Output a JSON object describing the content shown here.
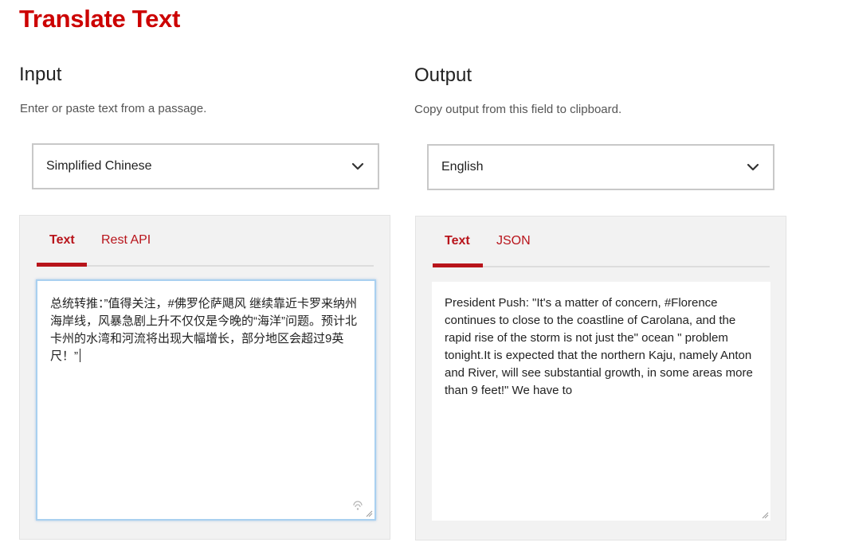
{
  "page": {
    "title": "Translate Text"
  },
  "input": {
    "heading": "Input",
    "description": "Enter or paste text from a passage.",
    "language": "Simplified Chinese",
    "tabs": [
      {
        "label": "Text",
        "active": true
      },
      {
        "label": "Rest API",
        "active": false
      }
    ],
    "text": "总统转推：”值得关注，#佛罗伦萨飓风 继续靠近卡罗来纳州海岸线，风暴急剧上升不仅仅是今晚的“海洋”问题。预计北卡州的水湾和河流将出现大幅增长，部分地区会超过9英尺！”"
  },
  "output": {
    "heading": "Output",
    "description": "Copy output from this field to clipboard.",
    "language": "English",
    "tabs": [
      {
        "label": "Text",
        "active": true
      },
      {
        "label": "JSON",
        "active": false
      }
    ],
    "text": "President Push: \"It's a matter of concern, #Florence continues to close to the coastline of Carolana, and the rapid rise of the storm is not just the\" ocean \" problem tonight.It is expected that the northern Kaju, namely Anton and River, will see substantial growth, in some areas more than 9 feet!\" We have to"
  },
  "icons": {
    "dropdown": "chevron-down-icon",
    "dictation": "dictation-icon",
    "resize": "resize-grip-icon"
  },
  "colors": {
    "brand": "#cc0000",
    "tab_accent": "#b8141b",
    "panel_bg": "#f2f2f2",
    "focus_border": "#a9d0f0"
  }
}
